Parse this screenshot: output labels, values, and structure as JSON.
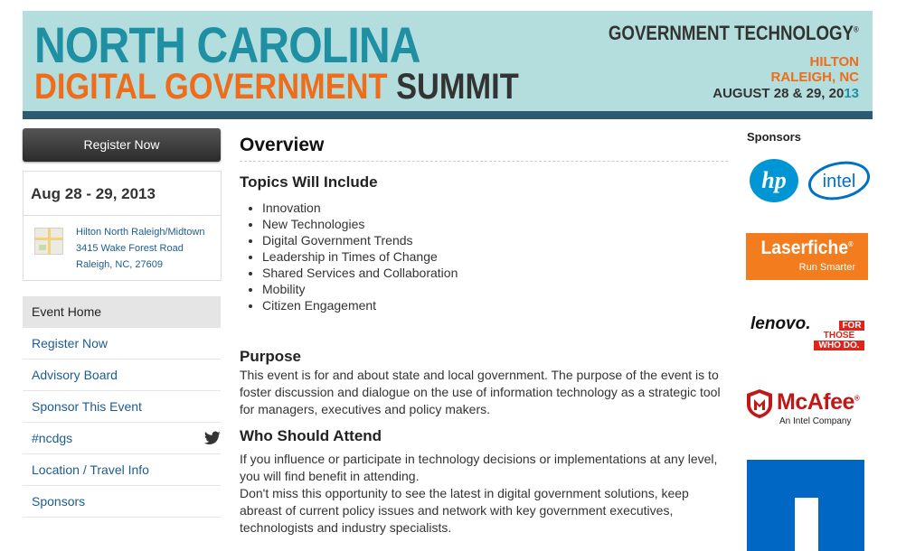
{
  "banner": {
    "title_line1": "NORTH CAROLINA",
    "title_line2_a": "DIGITAL GOVERNMENT",
    "title_line2_b": "SUMMIT",
    "publisher": "GOVERNMENT TECHNOLOGY",
    "publisher_mark": "®",
    "venue_line1": "HILTON",
    "venue_line2": "RALEIGH, NC",
    "dates_prefix": "AUGUST 28 & 29, 20",
    "dates_suffix": "13",
    "colors": {
      "background": "#b3dedd",
      "bar": "#2c5a73",
      "teal": "#1f8fa3",
      "orange": "#ef6c1a"
    }
  },
  "sidebar": {
    "register_label": "Register Now",
    "event_date": "Aug 28 - 29, 2013",
    "address": {
      "line1": "Hilton North Raleigh/Midtown",
      "line2": "3415 Wake Forest Road",
      "line3": "Raleigh, NC, 27609"
    },
    "nav": [
      {
        "label": "Event Home",
        "active": true
      },
      {
        "label": "Register Now"
      },
      {
        "label": "Advisory Board"
      },
      {
        "label": "Sponsor This Event"
      },
      {
        "label": "#ncdgs",
        "icon": "twitter-icon"
      },
      {
        "label": "Location / Travel Info"
      },
      {
        "label": "Sponsors"
      }
    ]
  },
  "main": {
    "heading": "Overview",
    "topics_heading": "Topics Will Include",
    "topics": [
      "Innovation",
      "New Technologies",
      "Digital Government Trends",
      "Leadership in Times of Change",
      "Shared Services and Collaboration",
      "Mobility",
      "Citizen Engagement"
    ],
    "purpose_heading": "Purpose",
    "purpose_text": "This event is for and about state and local government. The purpose of the event is to foster discussion and dialogue on the use of information technology as a strategic tool for managers, executives and policy makers.",
    "attend_heading": "Who Should Attend",
    "attend_text1": "If you influence or participate in technology decisions or implementations at any level, you will find benefit in attending.",
    "attend_text2": "Don't miss this opportunity to see the latest in digital government solutions, keep abreast of current policy issues and network with key government executives, technologists and industry specialists."
  },
  "sponsors": {
    "heading": "Sponsors",
    "logos": {
      "hp": "hp",
      "intel": "intel",
      "laserfiche": "Laserfiche",
      "laserfiche_mark": "®",
      "laserfiche_tag": "Run Smarter",
      "lenovo": "lenovo.",
      "lenovo_tag1": "FOR",
      "lenovo_tag2": "THOSE",
      "lenovo_tag3": "WHO DO.",
      "mcafee": "McAfee",
      "mcafee_mark": "®",
      "mcafee_tag": "An Intel Company"
    }
  }
}
